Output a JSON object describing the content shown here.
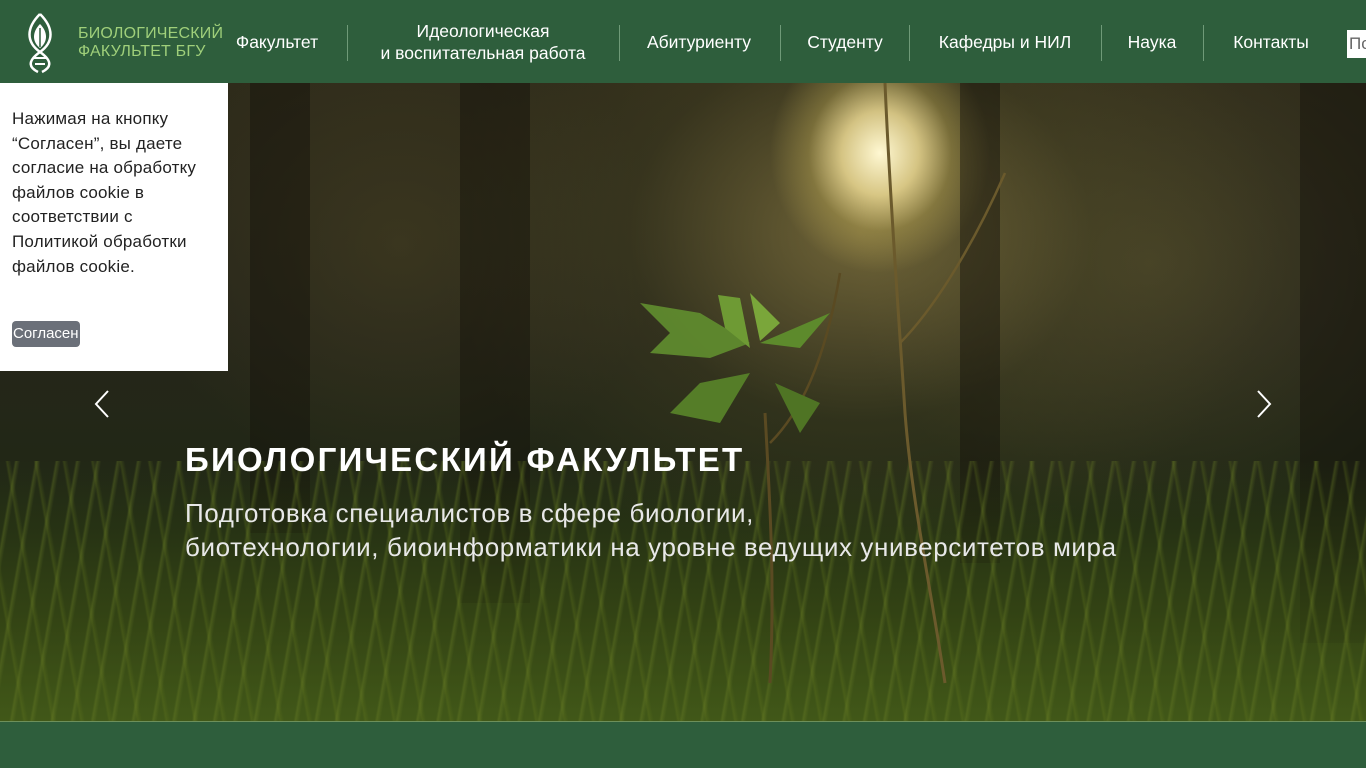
{
  "header": {
    "logo_line1": "БИОЛОГИЧЕСКИЙ",
    "logo_line2": "ФАКУЛЬТЕТ БГУ",
    "nav": [
      {
        "label": "Факультет"
      },
      {
        "label_line1": "Идеологическая",
        "label_line2": "и воспитательная работа"
      },
      {
        "label": "Абитуриенту"
      },
      {
        "label": "Студенту"
      },
      {
        "label": "Кафедры и НИЛ"
      },
      {
        "label": "Наука"
      },
      {
        "label": "Контакты"
      }
    ],
    "search_placeholder": "По"
  },
  "hero": {
    "title": "БИОЛОГИЧЕСКИЙ ФАКУЛЬТЕТ",
    "subtitle_line1": "Подготовка специалистов в сфере биологии,",
    "subtitle_line2": "биотехнологии, биоинформатики на уровне ведущих университетов мира",
    "prev_icon": "chevron-left-icon",
    "next_icon": "chevron-right-icon"
  },
  "cookie": {
    "text": "Нажимая на кнопку “Согласен”, вы даете согласие на обработку файлов cookie в соответствии с Политикой обработки файлов cookie.",
    "accept_label": "Согласен"
  },
  "colors": {
    "header_bg": "#2e5e3c",
    "logo_text": "#9fcf7a",
    "cookie_button": "#6b7079"
  }
}
